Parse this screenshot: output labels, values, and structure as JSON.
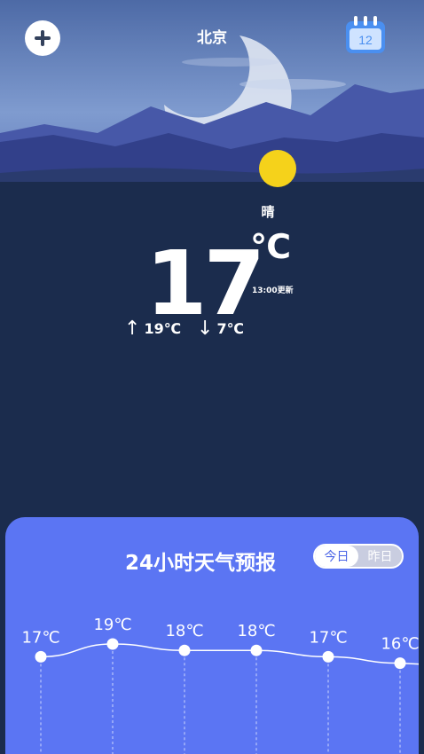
{
  "header": {
    "city": "北京",
    "add_icon": "plus-icon",
    "calendar_icon": "calendar-icon",
    "calendar_day": "12"
  },
  "current": {
    "condition": "晴",
    "temperature": "17",
    "unit": "℃",
    "updated": "13:00更新",
    "high": "19℃",
    "low": "7℃",
    "high_arrow": "↑",
    "low_arrow": "↓"
  },
  "colors": {
    "background": "#1b2c4d",
    "card": "#5b75f3",
    "sun": "#f5d21b"
  },
  "forecast": {
    "title": "24小时天气预报",
    "toggle_today": "今日",
    "toggle_yesterday": "昨日"
  },
  "chart_data": {
    "type": "line",
    "title": "24小时天气预报",
    "values": [
      17,
      19,
      18,
      18,
      17,
      16
    ],
    "labels": [
      "17℃",
      "19℃",
      "18℃",
      "18℃",
      "17℃",
      "16℃"
    ]
  }
}
